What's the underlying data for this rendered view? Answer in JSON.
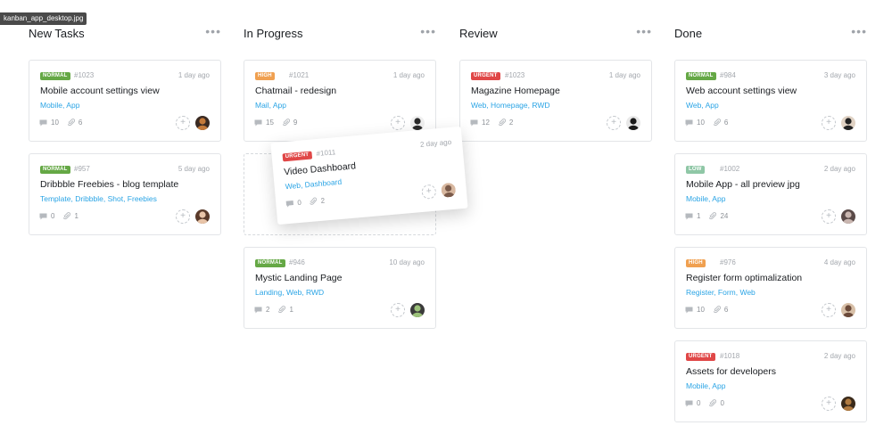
{
  "file_tag": "kanban_app_desktop.jpg",
  "colors": {
    "normal": "#65a845",
    "high": "#f0a050",
    "urgent": "#e04747",
    "low": "#8fc7a6",
    "tag_link": "#2aa4e5"
  },
  "columns": [
    {
      "title": "New Tasks",
      "menu": "•••",
      "cards": [
        {
          "priority": "NORMAL",
          "id": "#1023",
          "time": "1 day ago",
          "title": "Mobile account settings view",
          "tags": "Mobile, App",
          "comments": "10",
          "attachments": "6",
          "avatar": "avatar-1"
        },
        {
          "priority": "NORMAL",
          "id": "#957",
          "time": "5 day ago",
          "title": "Dribbble Freebies - blog template",
          "tags": "Template, Dribbble, Shot, Freebies",
          "comments": "0",
          "attachments": "1",
          "avatar": "avatar-2"
        }
      ]
    },
    {
      "title": "In Progress",
      "menu": "•••",
      "cards": [
        {
          "priority": "HIGH",
          "id": "#1021",
          "time": "1 day ago",
          "title": "Chatmail - redesign",
          "tags": "Mail, App",
          "comments": "15",
          "attachments": "9",
          "avatar": "avatar-3"
        },
        {
          "priority": "NORMAL",
          "id": "#946",
          "time": "10 day ago",
          "title": "Mystic Landing Page",
          "tags": "Landing, Web, RWD",
          "comments": "2",
          "attachments": "1",
          "avatar": "avatar-4"
        }
      ]
    },
    {
      "title": "Review",
      "menu": "•••",
      "cards": [
        {
          "priority": "URGENT",
          "id": "#1023",
          "time": "1 day ago",
          "title": "Magazine Homepage",
          "tags": "Web, Homepage, RWD",
          "comments": "12",
          "attachments": "2",
          "avatar": "avatar-5"
        }
      ]
    },
    {
      "title": "Done",
      "menu": "•••",
      "cards": [
        {
          "priority": "NORMAL",
          "id": "#984",
          "time": "3 day ago",
          "title": "Web account settings view",
          "tags": "Web, App",
          "comments": "10",
          "attachments": "6",
          "avatar": "avatar-6"
        },
        {
          "priority": "LOW",
          "id": "#1002",
          "time": "2 day ago",
          "title": "Mobile App - all preview jpg",
          "tags": "Mobile, App",
          "comments": "1",
          "attachments": "24",
          "avatar": "avatar-7"
        },
        {
          "priority": "HIGH",
          "id": "#976",
          "time": "4 day ago",
          "title": "Register form optimalization",
          "tags": "Register, Form, Web",
          "comments": "10",
          "attachments": "6",
          "avatar": "avatar-8"
        },
        {
          "priority": "URGENT",
          "id": "#1018",
          "time": "2 day ago",
          "title": "Assets for developers",
          "tags": "Mobile, App",
          "comments": "0",
          "attachments": "0",
          "avatar": "avatar-9"
        }
      ]
    }
  ],
  "dragging_card": {
    "priority": "URGENT",
    "id": "#1011",
    "time": "2 day ago",
    "title": "Video Dashboard",
    "tags": "Web, Dashboard",
    "comments": "0",
    "attachments": "2",
    "avatar": "avatar-10"
  }
}
